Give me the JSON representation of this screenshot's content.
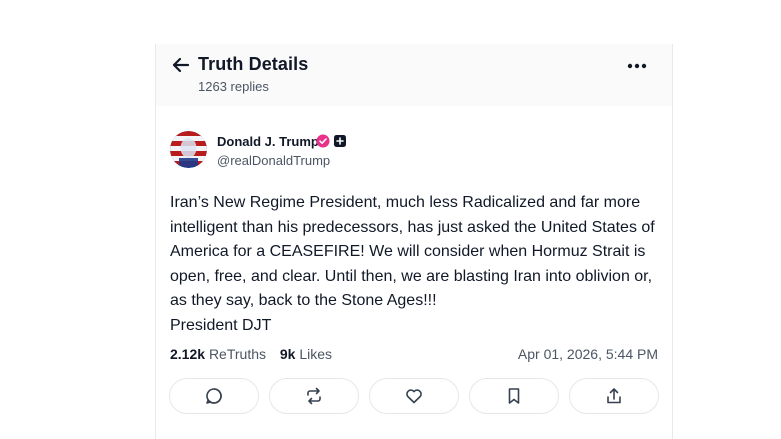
{
  "header": {
    "title": "Truth Details",
    "replies": "1263 replies",
    "back_icon": "arrow-left-icon",
    "more_icon": "more-horizontal-icon"
  },
  "post": {
    "author_name": "Donald J. Trump",
    "handle": "@realDonaldTrump",
    "verified_color": "#e9308a",
    "text": "Iran’s New Regime President, much less Radicalized and far more intelligent than his predecessors, has just asked the United States of America for a CEASEFIRE! We will consider when Hormuz Strait is open, free, and clear. Until then, we are blasting Iran into oblivion or, as they say, back to the Stone Ages!!!\nPresident DJT",
    "retruths_count": "2.12k",
    "retruths_label": "ReTruths",
    "likes_count": "9k",
    "likes_label": "Likes",
    "timestamp": "Apr 01, 2026, 5:44 PM"
  },
  "actions": [
    {
      "icon": "reply-icon"
    },
    {
      "icon": "retruth-icon"
    },
    {
      "icon": "like-icon"
    },
    {
      "icon": "bookmark-icon"
    },
    {
      "icon": "share-icon"
    }
  ]
}
